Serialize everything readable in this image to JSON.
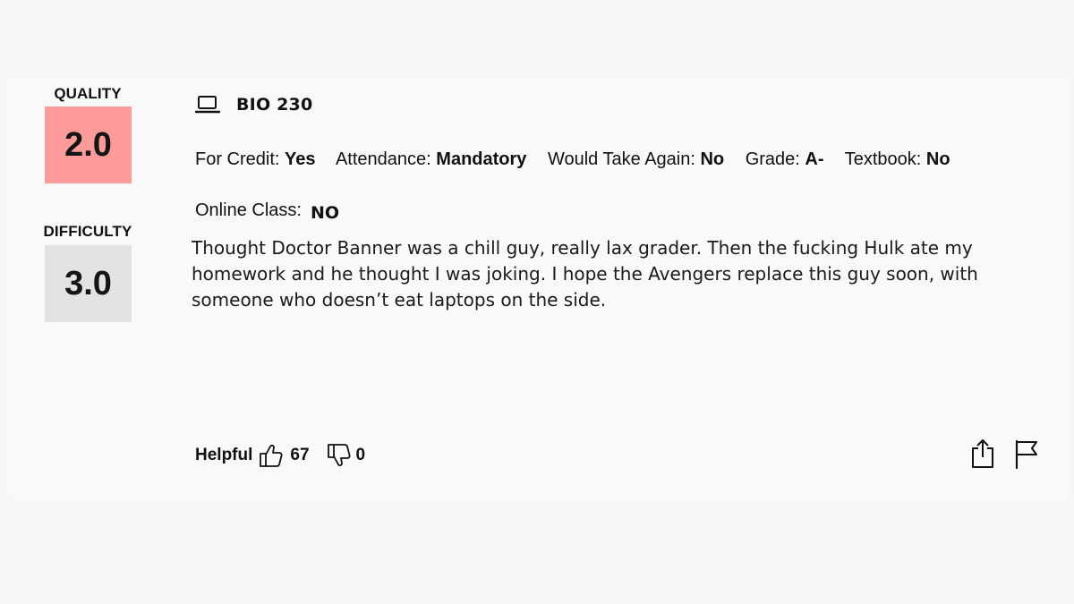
{
  "ratings": {
    "quality_label": "QUALITY",
    "quality_value": "2.0",
    "difficulty_label": "DIFFICULTY",
    "difficulty_value": "3.0",
    "quality_color": "#fc9b9a",
    "difficulty_color": "#e3e3e3"
  },
  "course": {
    "icon": "laptop-icon",
    "name": "BIO 230"
  },
  "meta": {
    "for_credit_label": "For Credit:",
    "for_credit_value": "Yes",
    "attendance_label": "Attendance:",
    "attendance_value": "Mandatory",
    "take_again_label": "Would Take Again:",
    "take_again_value": "No",
    "grade_label": "Grade:",
    "grade_value": "A-",
    "textbook_label": "Textbook:",
    "textbook_value": "No",
    "online_label": "Online Class:",
    "online_value": "NO"
  },
  "comment": "Thought Doctor Banner was a chill guy, really lax grader. Then the fucking Hulk ate my homework and he thought I was joking. I hope the Avengers replace this guy soon, with someone who doesn’t eat laptops on the side.",
  "footer": {
    "helpful_label": "Helpful",
    "thumbs_up_icon": "thumbs-up-icon",
    "thumbs_up_count": "67",
    "thumbs_down_icon": "thumbs-down-icon",
    "thumbs_down_count": "0",
    "share_icon": "share-icon",
    "flag_icon": "flag-icon"
  }
}
